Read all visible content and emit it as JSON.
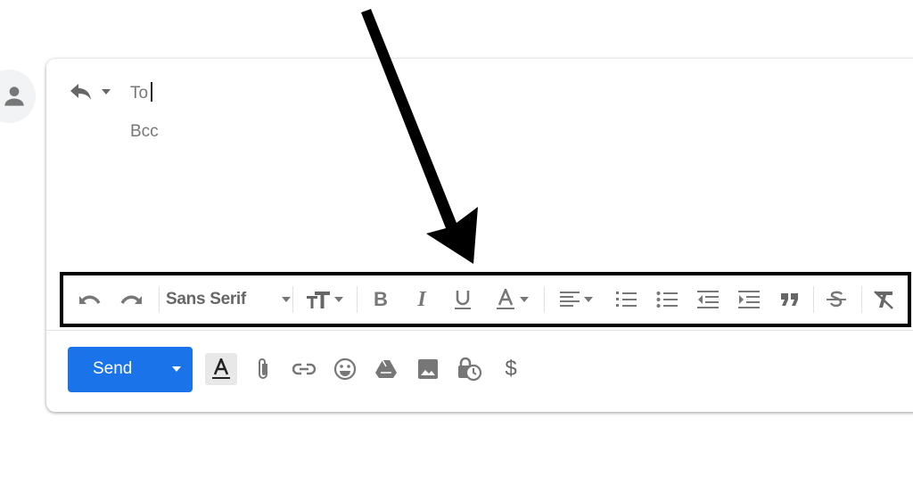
{
  "compose": {
    "to_label": "To",
    "bcc_label": "Bcc"
  },
  "toolbar": {
    "font_family": "Sans Serif",
    "items": [
      "undo-icon",
      "redo-icon",
      "font-family-select",
      "font-size-icon",
      "bold-icon",
      "italic-icon",
      "underline-icon",
      "text-color-icon",
      "align-icon",
      "numbered-list-icon",
      "bulleted-list-icon",
      "indent-less-icon",
      "indent-more-icon",
      "quote-icon",
      "strikethrough-icon",
      "remove-formatting-icon"
    ]
  },
  "bottom": {
    "send_label": "Send",
    "icons": [
      "formatting-options-icon",
      "attach-icon",
      "link-icon",
      "emoji-icon",
      "drive-icon",
      "photo-icon",
      "confidential-mode-icon",
      "dollar-icon"
    ]
  },
  "colors": {
    "accent": "#1a73e8",
    "highlight": "#000000",
    "icon": "#666666"
  }
}
